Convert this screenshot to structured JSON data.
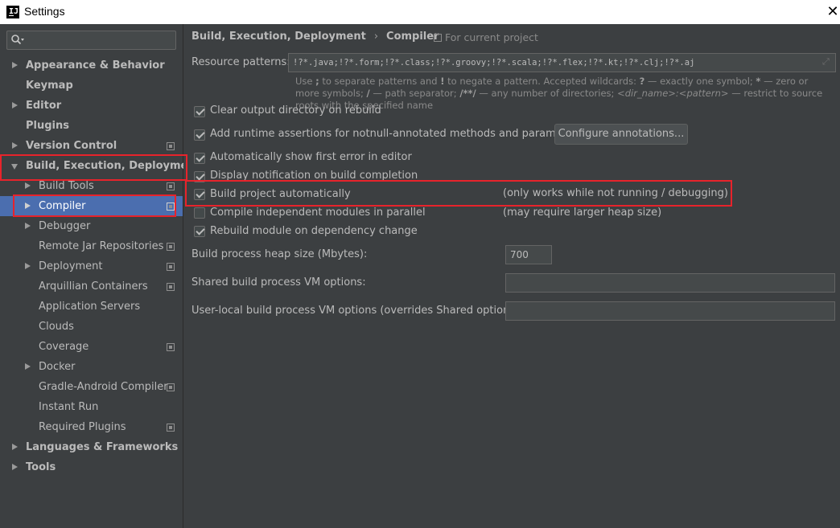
{
  "window": {
    "title": "Settings",
    "app_icon": "IJ",
    "close_glyph": "✕"
  },
  "sidebar": {
    "search_placeholder": "",
    "items": [
      {
        "label": "Appearance & Behavior"
      },
      {
        "label": "Keymap"
      },
      {
        "label": "Editor"
      },
      {
        "label": "Plugins"
      },
      {
        "label": "Version Control"
      },
      {
        "label": "Build, Execution, Deployment"
      },
      {
        "label": "Build Tools"
      },
      {
        "label": "Compiler"
      },
      {
        "label": "Debugger"
      },
      {
        "label": "Remote Jar Repositories"
      },
      {
        "label": "Deployment"
      },
      {
        "label": "Arquillian Containers"
      },
      {
        "label": "Application Servers"
      },
      {
        "label": "Clouds"
      },
      {
        "label": "Coverage"
      },
      {
        "label": "Docker"
      },
      {
        "label": "Gradle-Android Compiler"
      },
      {
        "label": "Instant Run"
      },
      {
        "label": "Required Plugins"
      },
      {
        "label": "Languages & Frameworks"
      },
      {
        "label": "Tools"
      }
    ]
  },
  "content": {
    "breadcrumb": {
      "parent": "Build, Execution, Deployment",
      "sep": "›",
      "current": "Compiler"
    },
    "for_project": "For current project",
    "resource_patterns": {
      "label": "Resource patterns:",
      "value": "!?*.java;!?*.form;!?*.class;!?*.groovy;!?*.scala;!?*.flex;!?*.kt;!?*.clj;!?*.aj"
    },
    "hint": {
      "p1": "Use ",
      "semi": ";",
      "p2": " to separate patterns and ",
      "bang": "!",
      "p3": " to negate a pattern. Accepted wildcards: ",
      "q": "?",
      "p4": " — exactly one symbol; ",
      "star": "*",
      "p5": " — zero or more symbols; ",
      "slash": "/",
      "p6": " — path separator; ",
      "dstar": "/**/",
      "p7": " — any number of directories; ",
      "dirname": "<dir_name>:<pattern>",
      "p8": " — restrict to source roots with the specified name"
    },
    "options": {
      "clear_output": {
        "label": "Clear output directory on rebuild",
        "checked": true
      },
      "runtime_assertions": {
        "label": "Add runtime assertions for notnull-annotated methods and parameters",
        "checked": true
      },
      "configure_annotations": "Configure annotations...",
      "show_first_error": {
        "label": "Automatically show first error in editor",
        "checked": true
      },
      "display_notification": {
        "label": "Display notification on build completion",
        "checked": true
      },
      "build_auto": {
        "label": "Build project automatically",
        "checked": true,
        "note": "(only works while not running / debugging)"
      },
      "compile_parallel": {
        "label": "Compile independent modules in parallel",
        "checked": false,
        "note": "(may require larger heap size)"
      },
      "rebuild_module": {
        "label": "Rebuild module on dependency change",
        "checked": true
      }
    },
    "heap_size": {
      "label": "Build process heap size (Mbytes):",
      "value": "700"
    },
    "shared_vm": {
      "label": "Shared build process VM options:",
      "value": ""
    },
    "user_vm": {
      "label": "User-local build process VM options (overrides Shared options):",
      "value": ""
    }
  }
}
